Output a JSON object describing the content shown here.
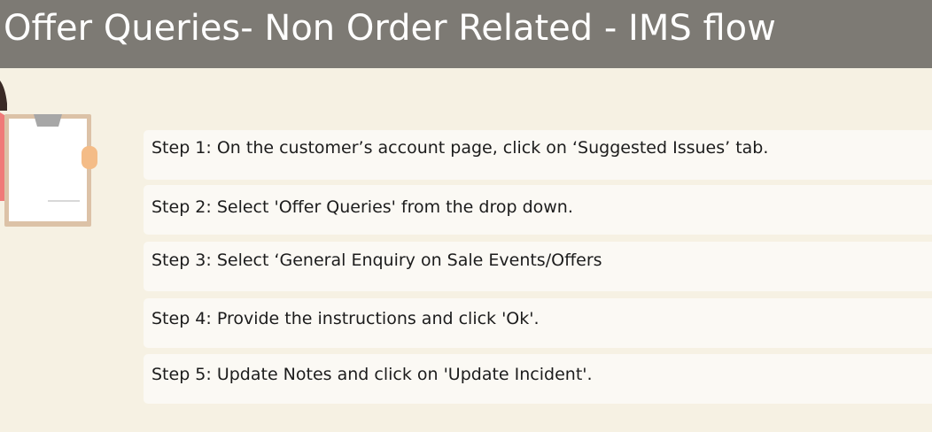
{
  "header": {
    "title": "Offer Queries- Non Order Related - IMS flow"
  },
  "illustration": {
    "icon": "person-holding-clipboard-icon"
  },
  "steps": [
    {
      "text": "Step 1: On the customer’s account page, click on ‘Suggested Issues’ tab."
    },
    {
      "text": "Step 2: Select 'Offer Queries' from the drop down."
    },
    {
      "text": "Step 3: Select ‘General Enquiry on Sale Events/Offers"
    },
    {
      "text": "Step 4: Provide the instructions and click 'Ok'."
    },
    {
      "text": "Step 5: Update Notes and click on 'Update Incident'."
    }
  ]
}
